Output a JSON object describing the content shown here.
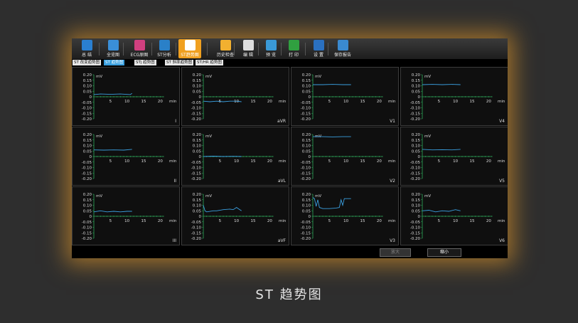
{
  "toolbar": {
    "items": [
      {
        "label": "总 结",
        "icon": "summary-icon",
        "color": "#2a7fd0"
      },
      {
        "label": "全览图",
        "icon": "overview-icon",
        "color": "#3a8fd8"
      },
      {
        "label": "ECG原图",
        "icon": "ecg-raw-icon",
        "color": "#d04080"
      },
      {
        "label": "ST分析",
        "icon": "st-analysis-icon",
        "color": "#2a80c8"
      },
      {
        "label": "ST趋势图",
        "icon": "st-trend-icon",
        "color": "#ffffff"
      },
      {
        "label": "历史检查",
        "icon": "history-icon",
        "color": "#f2b030"
      },
      {
        "label": "编 辑",
        "icon": "edit-icon",
        "color": "#dddddd"
      },
      {
        "label": "预 览",
        "icon": "preview-icon",
        "color": "#3a9ad8"
      },
      {
        "label": "打 印",
        "icon": "print-icon",
        "color": "#30a040"
      },
      {
        "label": "设 置",
        "icon": "settings-icon",
        "color": "#2a70c0"
      },
      {
        "label": "保存报告",
        "icon": "save-report-icon",
        "color": "#3a8ad0"
      }
    ]
  },
  "tabs": [
    "ST 改变趋势图",
    "ST 趋势图",
    "STj 趋势图",
    "ST 斜率趋势图",
    "ST/HR 趋势图"
  ],
  "selected_tab": 1,
  "chart_axis": {
    "y_ticks": [
      "0.20",
      "0.15",
      "0.10",
      "0.05",
      "0",
      "-0.05",
      "-0.10",
      "-0.15",
      "-0.20"
    ],
    "x_ticks": [
      "5",
      "10",
      "15",
      "20"
    ],
    "x_unit": "min",
    "y_unit": "mV"
  },
  "chart_data": [
    {
      "type": "line",
      "lead": "I",
      "x": [
        0,
        2,
        5,
        8,
        11,
        11.5
      ],
      "y": [
        0.02,
        0.025,
        0.022,
        0.025,
        0.02,
        0.03
      ],
      "xlim": [
        0,
        21
      ],
      "ylim": [
        -0.2,
        0.2
      ]
    },
    {
      "type": "line",
      "lead": "aVR",
      "x": [
        0,
        2,
        4,
        6,
        8,
        10,
        11.5
      ],
      "y": [
        -0.04,
        -0.045,
        -0.04,
        -0.045,
        -0.04,
        -0.04,
        -0.045
      ],
      "xlim": [
        0,
        21
      ],
      "ylim": [
        -0.2,
        0.2
      ]
    },
    {
      "type": "line",
      "lead": "V1",
      "x": [
        0,
        3,
        6,
        9,
        11.5
      ],
      "y": [
        0.11,
        0.11,
        0.112,
        0.11,
        0.11
      ],
      "xlim": [
        0,
        21
      ],
      "ylim": [
        -0.2,
        0.2
      ]
    },
    {
      "type": "line",
      "lead": "V4",
      "x": [
        0,
        3,
        6,
        9,
        11.5
      ],
      "y": [
        0.11,
        0.112,
        0.11,
        0.112,
        0.11
      ],
      "xlim": [
        0,
        21
      ],
      "ylim": [
        -0.2,
        0.2
      ]
    },
    {
      "type": "line",
      "lead": "II",
      "x": [
        0,
        3,
        6,
        9,
        11.5
      ],
      "y": [
        0.06,
        0.058,
        0.06,
        0.058,
        0.065
      ],
      "xlim": [
        0,
        21
      ],
      "ylim": [
        -0.2,
        0.2
      ]
    },
    {
      "type": "line",
      "lead": "aVL",
      "x": [
        0,
        3,
        6,
        9,
        11.5
      ],
      "y": [
        0.0,
        0.003,
        0.0,
        0.002,
        0.0
      ],
      "xlim": [
        0,
        21
      ],
      "ylim": [
        -0.2,
        0.2
      ]
    },
    {
      "type": "line",
      "lead": "V2",
      "x": [
        0,
        3,
        6,
        9,
        11.5
      ],
      "y": [
        0.18,
        0.18,
        0.178,
        0.18,
        0.18
      ],
      "xlim": [
        0,
        21
      ],
      "ylim": [
        -0.2,
        0.2
      ]
    },
    {
      "type": "line",
      "lead": "V5",
      "x": [
        0,
        3,
        6,
        9,
        11.5
      ],
      "y": [
        0.065,
        0.06,
        0.062,
        0.06,
        0.065
      ],
      "xlim": [
        0,
        21
      ],
      "ylim": [
        -0.2,
        0.2
      ]
    },
    {
      "type": "line",
      "lead": "III",
      "x": [
        0,
        2,
        4,
        6,
        8,
        10,
        11.5
      ],
      "y": [
        0.04,
        0.05,
        0.04,
        0.045,
        0.04,
        0.045,
        0.045
      ],
      "xlim": [
        0,
        21
      ],
      "ylim": [
        -0.2,
        0.2
      ]
    },
    {
      "type": "line",
      "lead": "aVF",
      "x": [
        0,
        0.5,
        1,
        3,
        4,
        6,
        8,
        9,
        10,
        11,
        11.5
      ],
      "y": [
        0.1,
        0.05,
        0.04,
        0.05,
        0.05,
        0.06,
        0.065,
        0.06,
        0.08,
        0.06,
        0.05
      ],
      "xlim": [
        0,
        21
      ],
      "ylim": [
        -0.2,
        0.2
      ]
    },
    {
      "type": "line",
      "lead": "V3",
      "x": [
        0,
        0.5,
        1,
        1.5,
        2,
        3,
        5,
        7,
        8,
        8.5,
        9,
        9.5,
        10,
        11.5
      ],
      "y": [
        0.17,
        0.16,
        0.09,
        0.15,
        0.08,
        0.07,
        0.07,
        0.075,
        0.08,
        0.15,
        0.1,
        0.16,
        0.16,
        0.16
      ],
      "xlim": [
        0,
        21
      ],
      "ylim": [
        -0.2,
        0.2
      ]
    },
    {
      "type": "line",
      "lead": "V6",
      "x": [
        0,
        2,
        4,
        6,
        8,
        10,
        11.5
      ],
      "y": [
        0.05,
        0.055,
        0.04,
        0.05,
        0.045,
        0.06,
        0.05
      ],
      "xlim": [
        0,
        21
      ],
      "ylim": [
        -0.2,
        0.2
      ]
    }
  ],
  "buttons": {
    "zoom_in": "放大",
    "zoom_out": "缩小"
  },
  "caption": "ST 趋势图",
  "colors": {
    "trace": "#3a9fdf",
    "axis": "#2ea85a",
    "active_tool": "#f0a020",
    "selected_tab": "#3aa0e0"
  }
}
